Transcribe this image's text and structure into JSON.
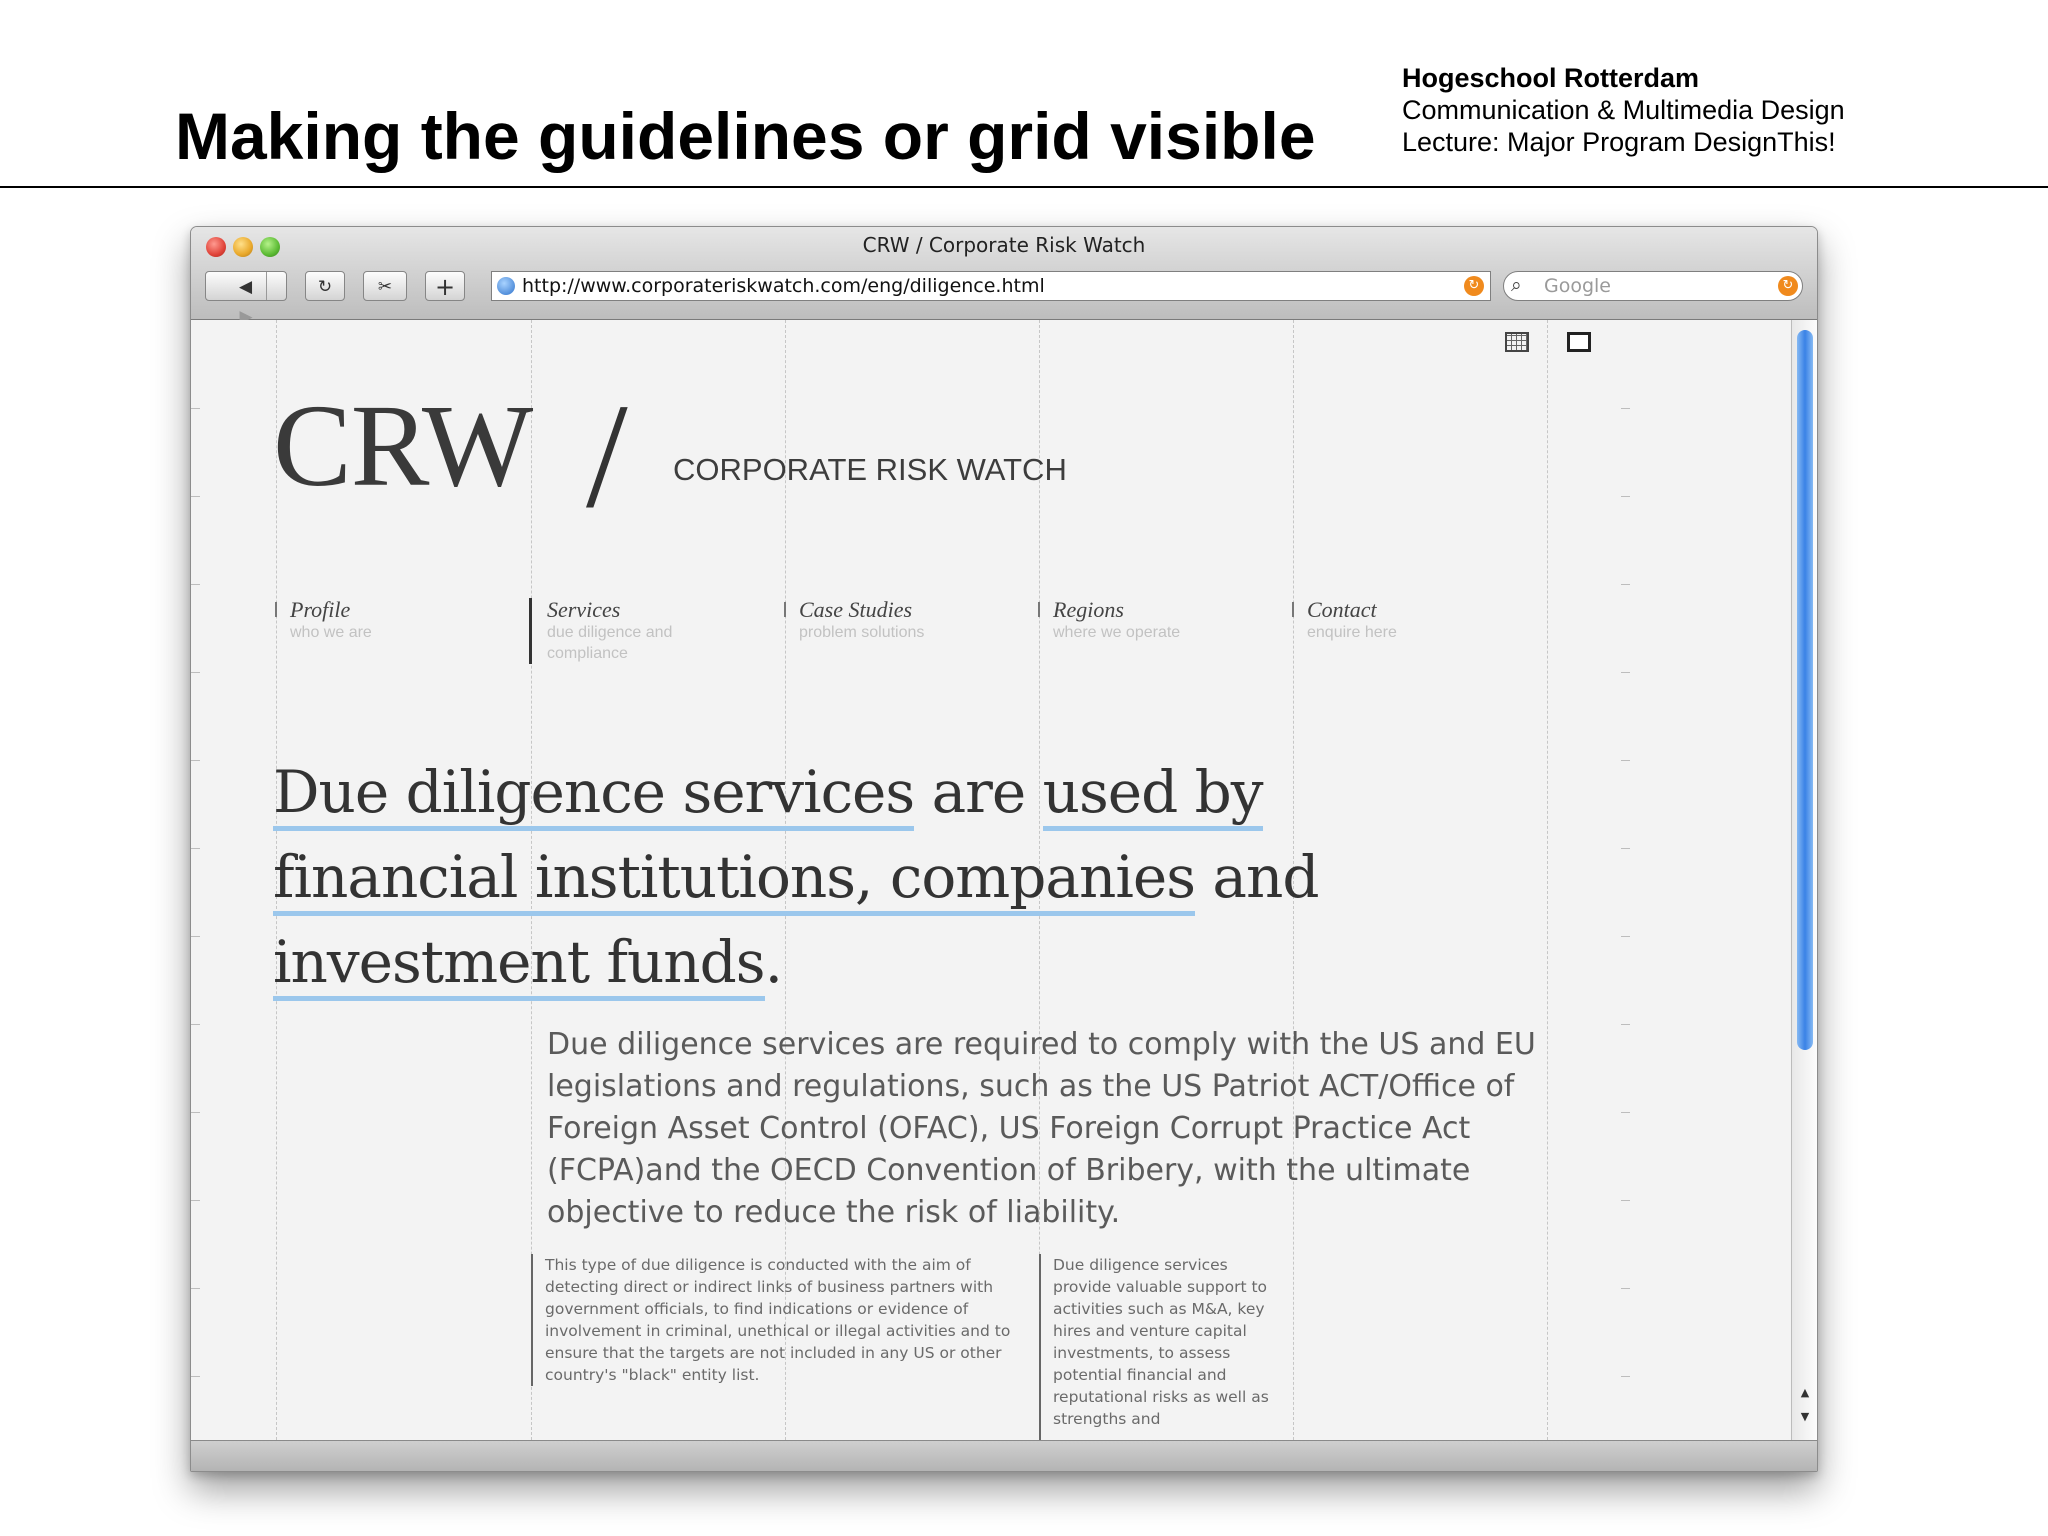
{
  "slide": {
    "title": "Making the guidelines or grid visible",
    "school_name": "Hogeschool Rotterdam",
    "program": "Communication & Multimedia Design",
    "lecture": "Lecture: Major Program DesignThis!"
  },
  "browser": {
    "window_title": "CRW / Corporate Risk Watch",
    "url": "http://www.corporateriskwatch.com/eng/diligence.html",
    "search_placeholder": "Google"
  },
  "page": {
    "logo": "CRW",
    "logo_slash": "/",
    "tagline": "CORPORATE RISK WATCH",
    "nav": [
      {
        "title": "Profile",
        "sub": "who we are",
        "active": false
      },
      {
        "title": "Services",
        "sub": "due diligence and compliance",
        "active": true
      },
      {
        "title": "Case Studies",
        "sub": "problem solutions",
        "active": false
      },
      {
        "title": "Regions",
        "sub": "where we operate",
        "active": false
      },
      {
        "title": "Contact",
        "sub": "enquire here",
        "active": false
      }
    ],
    "headline": {
      "part1": "Due diligence services",
      "part2": " are ",
      "part3": "used by",
      "part4": "financial institutions, companies",
      "part5": " and",
      "part6": "investment funds",
      "part7": "."
    },
    "lead": "Due diligence services are required to comply with the US and EU legislations and regulations, such as the US Patriot ACT/Office of Foreign Asset Control (OFAC), US Foreign Corrupt Practice Act (FCPA)and the OECD Convention of Bribery, with the ultimate objective to reduce the risk of liability.",
    "col_a": "This type of due diligence is conducted with the aim of detecting direct or indirect links of business partners with government officials, to find indications or evidence of involvement in criminal, unethical or illegal activities and to ensure that the targets are not included in any US or other country's \"black\" entity list.",
    "col_b": "Due diligence services provide valuable support to activities such as M&A, key hires and venture capital investments, to assess potential financial and reputational risks as well as strengths and"
  },
  "colors": {
    "underline": "#9bc7ec",
    "scroll_thumb": "#3a82e6",
    "rss_orange": "#f08a1d"
  },
  "icons": [
    "close-icon",
    "minimize-icon",
    "zoom-icon",
    "back-icon",
    "forward-icon",
    "reload-icon",
    "snippet-icon",
    "add-icon",
    "globe-icon",
    "rss-icon",
    "search-icon",
    "grid-icon",
    "columns-icon"
  ]
}
